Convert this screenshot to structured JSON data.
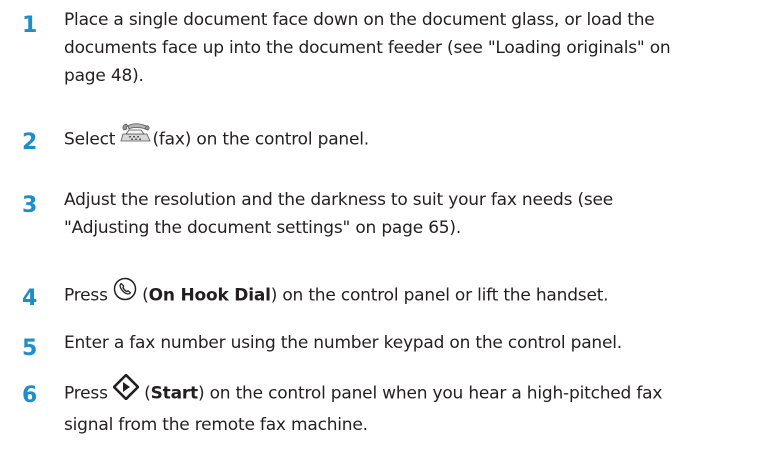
{
  "steps": [
    {
      "number": "1",
      "lines": [
        "Place a single document face down on the document glass, or load the",
        "documents face up into the document feeder (see \"Loading originals\" on",
        "page 48)."
      ]
    },
    {
      "number": "2",
      "before": "Select ",
      "icon": "fax-icon",
      "after": "(fax) on the control panel."
    },
    {
      "number": "3",
      "lines": [
        "Adjust the resolution and the darkness to suit your fax needs (see",
        "\"Adjusting the document settings\" on page 65)."
      ]
    },
    {
      "number": "4",
      "before": "Press ",
      "icon": "on-hook-dial-icon",
      "paren_open": " (",
      "bold": "On Hook Dial",
      "after": ") on the control panel or lift the handset."
    },
    {
      "number": "5",
      "text": "Enter a fax number using the number keypad on the control panel."
    },
    {
      "number": "6",
      "before": "Press ",
      "icon": "start-icon",
      "paren_open": " (",
      "bold": "Start",
      "after": ") on the control panel when you hear a high-pitched fax",
      "line2": "signal from the remote fax machine."
    }
  ],
  "colors": {
    "step_number": "#1b8fcc",
    "body_text": "#231f20"
  }
}
